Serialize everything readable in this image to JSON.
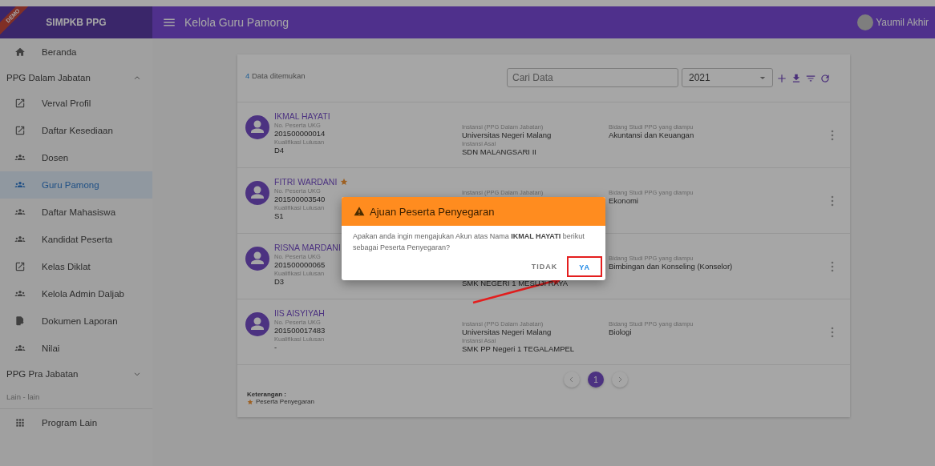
{
  "app": {
    "ribbon": "DEMO",
    "brand": "SIMPKB PPG"
  },
  "topbar": {
    "title": "Kelola Guru Pamong",
    "user": "Yaumil Akhir"
  },
  "sidebar": {
    "items": [
      {
        "kind": "link",
        "label": "Beranda",
        "selected": false
      },
      {
        "kind": "group",
        "label": "PPG Dalam Jabatan",
        "expanded": true
      },
      {
        "kind": "link",
        "label": "Verval Profil",
        "selected": false
      },
      {
        "kind": "link",
        "label": "Daftar Kesediaan",
        "selected": false
      },
      {
        "kind": "link",
        "label": "Dosen",
        "selected": false
      },
      {
        "kind": "link",
        "label": "Guru Pamong",
        "selected": true
      },
      {
        "kind": "link",
        "label": "Daftar Mahasiswa",
        "selected": false
      },
      {
        "kind": "link",
        "label": "Kandidat Peserta",
        "selected": false
      },
      {
        "kind": "link",
        "label": "Kelas Diklat",
        "selected": false
      },
      {
        "kind": "link",
        "label": "Kelola Admin Daljab",
        "selected": false
      },
      {
        "kind": "link",
        "label": "Dokumen Laporan",
        "selected": false
      },
      {
        "kind": "link",
        "label": "Nilai",
        "selected": false
      },
      {
        "kind": "group",
        "label": "PPG Pra Jabatan",
        "expanded": false
      },
      {
        "kind": "section",
        "label": "Lain - lain"
      },
      {
        "kind": "link",
        "label": "Program Lain",
        "selected": false
      }
    ]
  },
  "list": {
    "count": "4",
    "count_label": "Data ditemukan",
    "search": {
      "placeholder": "Cari Data"
    },
    "year": "2021",
    "rows": [
      {
        "name": "IKMAL HAYATI",
        "refresher": false,
        "columns": [
          [
            {
              "label": "No. Peserta UKG",
              "value": "201500000014"
            },
            {
              "label": "Kualifikasi Lulusan",
              "value": "D4"
            }
          ],
          [
            {
              "label": "Instansi (PPG Dalam Jabatan)",
              "value": "Universitas Negeri Malang"
            },
            {
              "label": "Instansi Asal",
              "value": "SDN MALANGSARI II"
            }
          ],
          [
            {
              "label": "Bidang Studi PPG yang diampu",
              "value": "Akuntansi dan Keuangan"
            }
          ]
        ]
      },
      {
        "name": "FITRI WARDANI",
        "refresher": true,
        "columns": [
          [
            {
              "label": "No. Peserta UKG",
              "value": "201500003540"
            },
            {
              "label": "Kualifikasi Lulusan",
              "value": "S1"
            }
          ],
          [
            {
              "label": "Instansi (PPG Dalam Jabatan)"
            }
          ],
          [
            {
              "label": "Bidang Studi PPG yang diampu",
              "value": "Ekonomi"
            }
          ]
        ]
      },
      {
        "name": "RISNA MARDANI",
        "refresher": false,
        "columns": [
          [
            {
              "label": "No. Peserta UKG",
              "value": "201500000065"
            },
            {
              "label": "Kualifikasi Lulusan",
              "value": "D3"
            }
          ],
          [
            {},
            {
              "value": "SMK NEGERI 1 MESUJI RAYA"
            }
          ],
          [
            {
              "label": "Bidang Studi PPG yang diampu",
              "value": "Bimbingan dan Konseling (Konselor)"
            }
          ]
        ]
      },
      {
        "name": "IIS AISYIYAH",
        "refresher": false,
        "columns": [
          [
            {
              "label": "No. Peserta UKG",
              "value": "201500017483"
            },
            {
              "label": "Kualifikasi Lulusan",
              "value": "-"
            }
          ],
          [
            {
              "label": "Instansi (PPG Dalam Jabatan)",
              "value": "Universitas Negeri Malang"
            },
            {
              "label": "Instansi Asal",
              "value": "SMK PP Negeri 1 TEGALAMPEL"
            }
          ],
          [
            {
              "label": "Bidang Studi PPG yang diampu",
              "value": "Biologi"
            }
          ]
        ]
      }
    ],
    "pages": [
      {
        "label": "1",
        "selected": true
      }
    ],
    "legend": {
      "title": "Keterangan :",
      "item": "Peserta Penyegaran"
    }
  },
  "dialog": {
    "title": "Ajuan Peserta Penyegaran",
    "message": "Apakan anda ingin mengajukan Akun atas Nama **IKMAL HAYATI** berikut sebagai Peserta Penyegaran?",
    "buttons": [
      {
        "label": "TIDAK",
        "highlighted": false
      },
      {
        "label": "YA",
        "highlighted": true
      }
    ]
  }
}
